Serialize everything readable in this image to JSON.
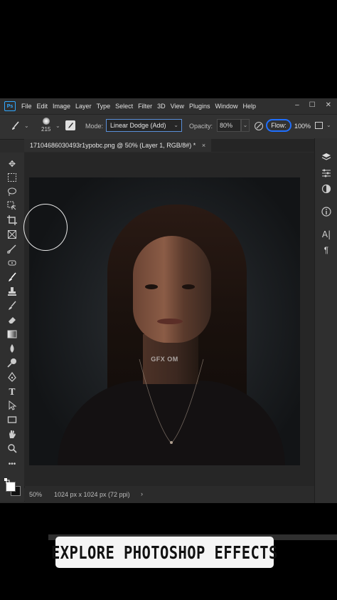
{
  "app": {
    "logo": "Ps"
  },
  "menu": [
    "File",
    "Edit",
    "Image",
    "Layer",
    "Type",
    "Select",
    "Filter",
    "3D",
    "View",
    "Plugins",
    "Window",
    "Help"
  ],
  "window_controls": [
    "–",
    "☐",
    "✕"
  ],
  "options_bar": {
    "brush_size": "215",
    "mode_label": "Mode:",
    "mode_value": "Linear Dodge (Add)",
    "opacity_label": "Opacity:",
    "opacity_value": "80%",
    "flow_label": "Flow:",
    "flow_value": "100%"
  },
  "document_tab": {
    "title": "17104686030493r1ypobc.png @ 50% (Layer 1, RGB/8#) *",
    "close": "×"
  },
  "canvas": {
    "watermark": "GFX OM"
  },
  "status": {
    "zoom": "50%",
    "info": "1024 px x 1024 px (72 ppi)",
    "arrow": "›"
  },
  "caption": "EXPLORE PHOTOSHOP EFFECTS",
  "accent_colors": {
    "ps_blue": "#31a8ff",
    "flow_highlight": "#1f6fff",
    "mode_border": "#5a8fd8"
  },
  "tools": [
    "move-icon",
    "marquee-icon",
    "lasso-icon",
    "object-select-icon",
    "crop-icon",
    "frame-icon",
    "eyedropper-icon",
    "spot-healing-icon",
    "brush-icon",
    "stamp-icon",
    "history-brush-icon",
    "eraser-icon",
    "gradient-icon",
    "blur-icon",
    "dodge-icon",
    "pen-icon",
    "type-icon",
    "path-select-icon",
    "rectangle-icon",
    "hand-icon",
    "zoom-icon",
    "more-tools-icon",
    "default-colors-icon"
  ],
  "panels": [
    "layers-icon",
    "adjustments-icon",
    "channels-icon",
    "info-icon",
    "character-icon",
    "paragraph-icon"
  ]
}
